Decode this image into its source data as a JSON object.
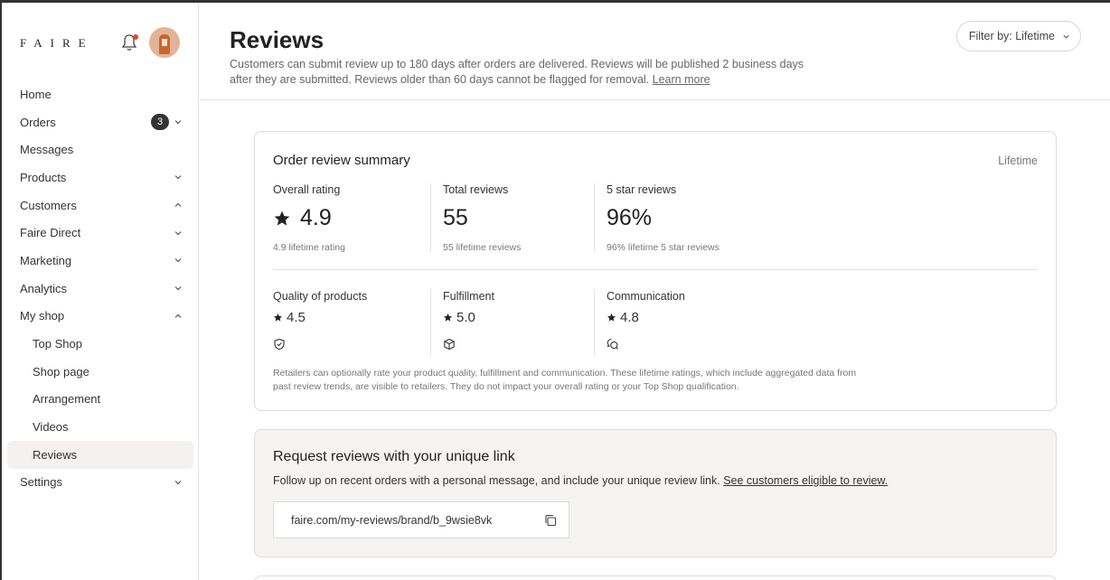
{
  "brand": {
    "logo_text": "FAIRE"
  },
  "sidebar": {
    "items": [
      {
        "label": "Home"
      },
      {
        "label": "Orders",
        "badge": "3"
      },
      {
        "label": "Messages"
      },
      {
        "label": "Products"
      },
      {
        "label": "Customers"
      },
      {
        "label": "Faire Direct"
      },
      {
        "label": "Marketing"
      },
      {
        "label": "Analytics"
      },
      {
        "label": "My shop"
      },
      {
        "label": "Top Shop"
      },
      {
        "label": "Shop page"
      },
      {
        "label": "Arrangement"
      },
      {
        "label": "Videos"
      },
      {
        "label": "Reviews"
      },
      {
        "label": "Settings"
      }
    ]
  },
  "header": {
    "title": "Reviews",
    "description": "Customers can submit review up to 180 days after orders are delivered. Reviews will be published 2 business days after they are submitted. Reviews older than 60 days cannot be flagged for removal.",
    "learn_more": "Learn more",
    "filter_label": "Filter by: Lifetime"
  },
  "summary": {
    "title": "Order review summary",
    "period": "Lifetime",
    "stats": [
      {
        "label": "Overall rating",
        "value": "4.9",
        "sub": "4.9 lifetime rating"
      },
      {
        "label": "Total reviews",
        "value": "55",
        "sub": "55 lifetime reviews"
      },
      {
        "label": "5 star reviews",
        "value": "96%",
        "sub": "96% lifetime 5 star reviews"
      }
    ],
    "subratings": [
      {
        "label": "Quality of products",
        "value": "4.5"
      },
      {
        "label": "Fulfillment",
        "value": "5.0"
      },
      {
        "label": "Communication",
        "value": "4.8"
      }
    ],
    "note": "Retailers can optionally rate your product quality, fulfillment and communication. These lifetime ratings, which include aggregated data from past review trends, are visible to retailers. They do not impact your overall rating or your Top Shop qualification."
  },
  "request": {
    "title": "Request reviews with your unique link",
    "description": "Follow up on recent orders with a personal message, and include your unique review link.",
    "link_label": "See customers eligible to review.",
    "review_link": "faire.com/my-reviews/brand/b_9wsie8vk"
  },
  "colors": {
    "accent_dot": "#d94b2b",
    "active_bg": "#f3f2f0",
    "badge_bg": "#333333"
  }
}
